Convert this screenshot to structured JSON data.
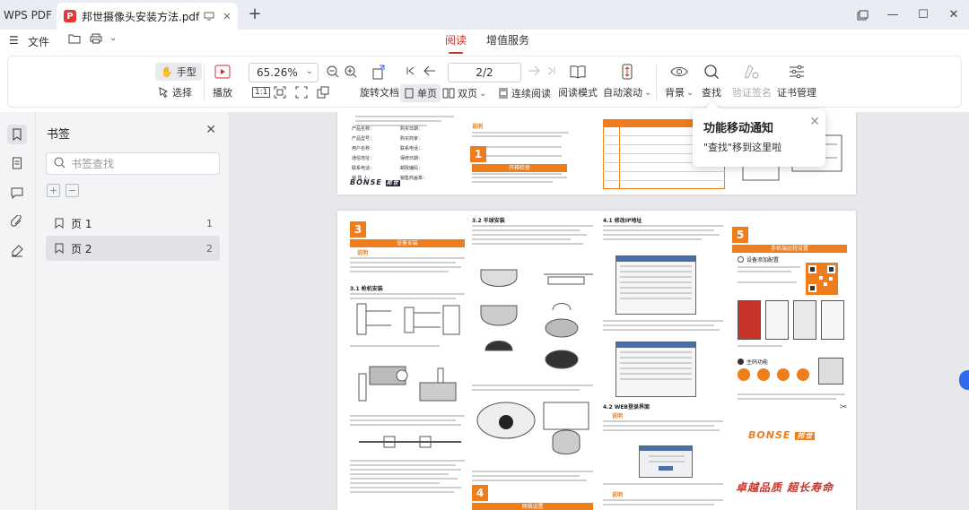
{
  "titlebar": {
    "app": "WPS PDF",
    "doc_title": "邦世摄像头安装方法.pdf"
  },
  "menubar": {
    "file": "文件",
    "tabs": [
      {
        "label": "阅读",
        "active": true
      },
      {
        "label": "增值服务",
        "active": false
      }
    ]
  },
  "toolbar": {
    "hand": "手型",
    "select": "选择",
    "play": "播放",
    "zoom": "65.26%",
    "page": "2/2",
    "rotate": "旋转文档",
    "single": "单页",
    "double": "双页",
    "continuous": "连续阅读",
    "read_mode": "阅读模式",
    "auto_scroll": "自动滚动",
    "background": "背景",
    "find": "查找",
    "verify": "验证签名",
    "cert": "证书管理"
  },
  "notify": {
    "title": "功能移动通知",
    "body": "\"查找\"移到这里啦"
  },
  "bookmarks": {
    "header": "书签",
    "search_placeholder": "书签查找",
    "items": [
      {
        "label": "页 1",
        "page": "1"
      },
      {
        "label": "页 2",
        "page": "2"
      }
    ]
  },
  "doc": {
    "p1": {
      "product_rows": [
        "产品名称：",
        "产品型号：",
        "用户名称：",
        "通信地址：",
        "联系电话：",
        "销 售 人："
      ],
      "right_rows": [
        "购买日期：",
        "购买商家：",
        "联系电话：",
        "保修日期：",
        "邮政编码：",
        "销售商盖章："
      ],
      "section_num": "1",
      "section_title": "开箱检查",
      "note_label": "说明",
      "brand": "BONSE",
      "brand_cn": "邦世"
    },
    "p2": {
      "sec3_num": "3",
      "sec3_title": "设备安装",
      "sec3_1": "3.1 枪机安装",
      "sec3_2": "3.2 半球安装",
      "sec4_num": "4",
      "sec4_title": "网络设置",
      "sec4_1": "4.1 修改IP地址",
      "sec4_2": "4.2 WEB登录界面",
      "sec5_num": "5",
      "sec5_title": "手机端远程设置",
      "sec5_1": "设备添加配置",
      "sec5_2": "主码功能",
      "brand": "BONSE",
      "brand_cn": "邦世",
      "slogan": "卓越品质 超长寿命",
      "note_label": "说明"
    }
  },
  "colors": {
    "accent": "#c8332a",
    "doc_orange": "#ee7d1e",
    "selection_bg": "#e0e2e6"
  },
  "icons": [
    "bookmark-icon",
    "thumbnail-icon",
    "comment-icon",
    "attachment-icon",
    "sign-icon",
    "search-icon",
    "close-icon"
  ]
}
